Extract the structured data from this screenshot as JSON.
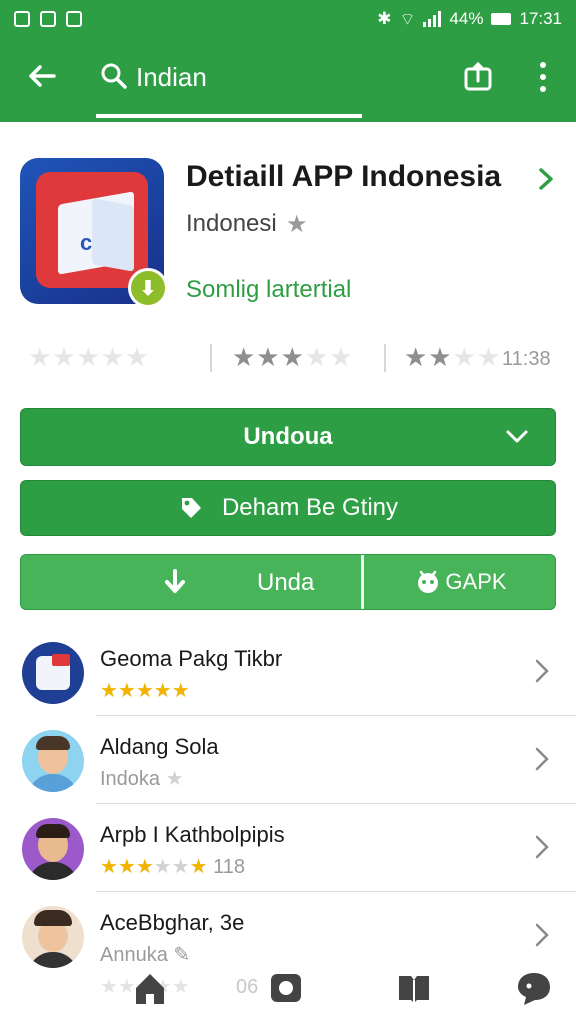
{
  "status_bar": {
    "battery": "44%",
    "time": "17:31"
  },
  "search": {
    "query": "Indian"
  },
  "app": {
    "title": "Detiaill APP Indonesia",
    "developer": "Indonesi",
    "tagline": "Somlig lartertial",
    "icon": "book-app-icon",
    "badge_icon": "download-badge-icon"
  },
  "rating_strip": {
    "group1": {
      "filled": 0,
      "total": 5
    },
    "group2": {
      "filled": 3,
      "total": 5
    },
    "group3": {
      "filled": 2,
      "total": 4
    },
    "count": "11:38"
  },
  "buttons": {
    "primary_label": "Undoua",
    "secondary_label": "Deham Be Gtiny",
    "download_label": "Unda",
    "apk_label": "GAPK"
  },
  "list": {
    "items": [
      {
        "name": "Geoma Pakg Tikbr",
        "sub": "★★★★★",
        "sub_type": "stars-gold",
        "avatar": "app-icon-avatar"
      },
      {
        "name": "Aldang Sola",
        "sub": "Indoka",
        "sub_extra": "★",
        "sub_type": "text",
        "avatar": "man-avatar-blue"
      },
      {
        "name": "Arpb I Kathbolpipis",
        "sub": "★★★",
        "sub_grey": "★★",
        "sub_gold2": "★",
        "sub_count": "118",
        "sub_type": "stars-mixed",
        "avatar": "man-avatar-purple"
      },
      {
        "name": "AceBbghar, 3e",
        "sub": "Annuka",
        "sub_extra": "✎",
        "sub2": "06",
        "sub_type": "text",
        "avatar": "man-avatar-hat"
      }
    ]
  },
  "bottom_nav": [
    "home-icon",
    "camera-icon",
    "book-icon",
    "chat-icon"
  ],
  "colors": {
    "primary": "#2e9e44",
    "star_gold": "#f0b400"
  }
}
